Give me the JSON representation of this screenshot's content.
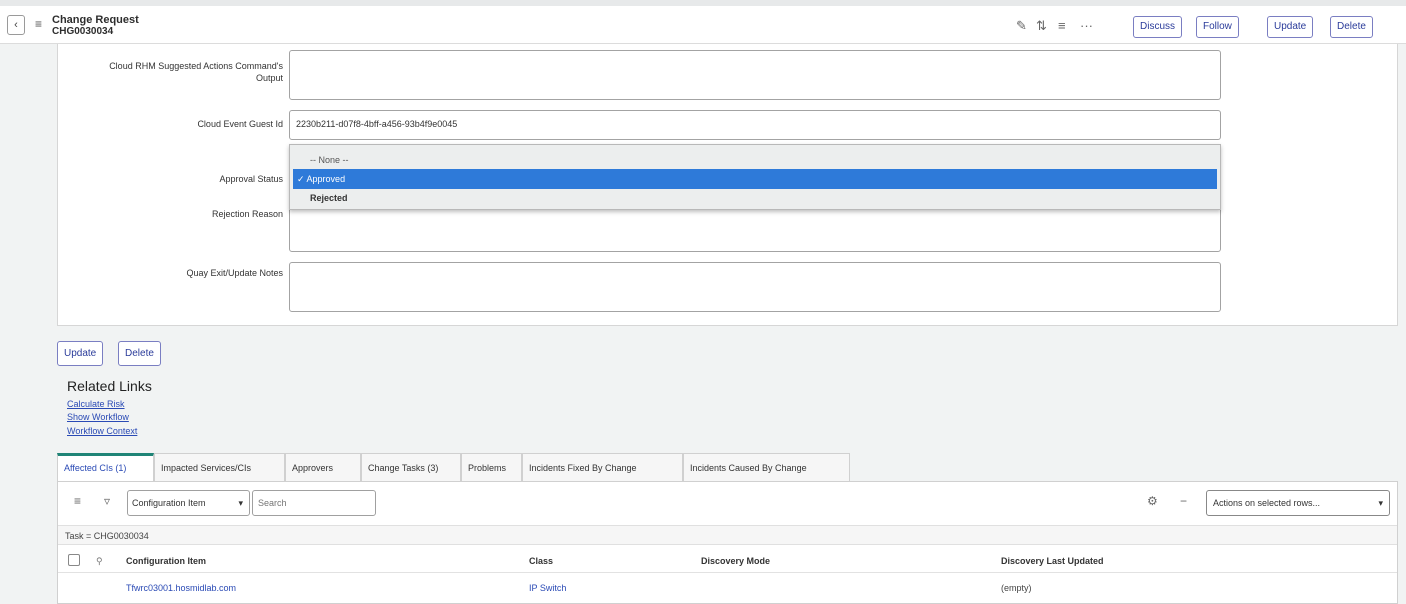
{
  "header": {
    "title": "Change Request",
    "number": "CHG0030034",
    "back_icon": "chevron-left-icon",
    "menu_icon": "hamburger-icon",
    "attach_icon": "paperclip-icon",
    "activity_icon": "activity-icon",
    "settings_icon": "sliders-icon",
    "more_label": "···",
    "buttons": {
      "discuss": "Discuss",
      "follow": "Follow",
      "update": "Update",
      "delete": "Delete"
    }
  },
  "form": {
    "cloud_output_label_line1": "Cloud RHM Suggested Actions Command's",
    "cloud_output_label_line2": "Output",
    "event_id_label": "Cloud Event Guest Id",
    "event_id_value": "2230b211-d07f8-4bff-a456-93b4f9e0045",
    "approval_label": "Approval Status",
    "rejection_label": "Rejection Reason",
    "notes_label": "Quay Exit/Update Notes"
  },
  "dropdown": {
    "none_option": "-- None --",
    "selected_option": "✓ Approved",
    "other_option": "Rejected"
  },
  "footer_buttons": {
    "update": "Update",
    "delete": "Delete"
  },
  "related": {
    "title": "Related Links",
    "links": [
      "Calculate Risk",
      "Show Workflow",
      "Workflow Context"
    ]
  },
  "tabs": [
    "Affected CIs (1)",
    "Impacted Services/CIs",
    "Approvers",
    "Change Tasks (3)",
    "Problems",
    "Incidents Fixed By Change",
    "Incidents Caused By Change"
  ],
  "list": {
    "field_select": "Configuration Item",
    "search_placeholder": "Search",
    "actions_select": "Actions on selected rows...",
    "filter_text": "Task = CHG0030034",
    "columns": [
      "Configuration Item",
      "Class",
      "Discovery Mode",
      "Discovery Last Updated"
    ],
    "rows": [
      {
        "ci": "Tfwrc03001.hosmidlab.com",
        "class": "IP Switch",
        "mode": "",
        "updated": "(empty)"
      }
    ]
  },
  "colors": {
    "accent": "#2e7ad9",
    "button_border": "#7a7ec2",
    "tab_accent": "#1f8476",
    "link": "#2a4ab5"
  }
}
